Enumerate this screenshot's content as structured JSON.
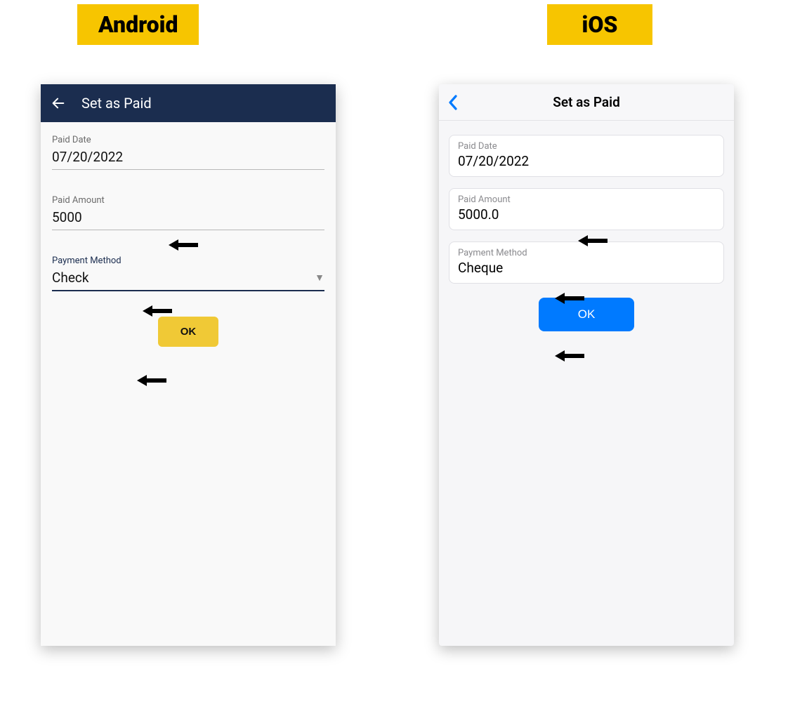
{
  "labels": {
    "android": "Android",
    "ios": "iOS"
  },
  "android": {
    "title": "Set as Paid",
    "fields": {
      "paid_date": {
        "label": "Paid Date",
        "value": "07/20/2022"
      },
      "paid_amount": {
        "label": "Paid Amount",
        "value": "5000"
      },
      "payment_method": {
        "label": "Payment Method",
        "value": "Check"
      }
    },
    "ok": "OK"
  },
  "ios": {
    "title": "Set as Paid",
    "fields": {
      "paid_date": {
        "label": "Paid Date",
        "value": "07/20/2022"
      },
      "paid_amount": {
        "label": "Paid Amount",
        "value": "5000.0"
      },
      "payment_method": {
        "label": "Payment Method",
        "value": "Cheque"
      }
    },
    "ok": "OK"
  }
}
